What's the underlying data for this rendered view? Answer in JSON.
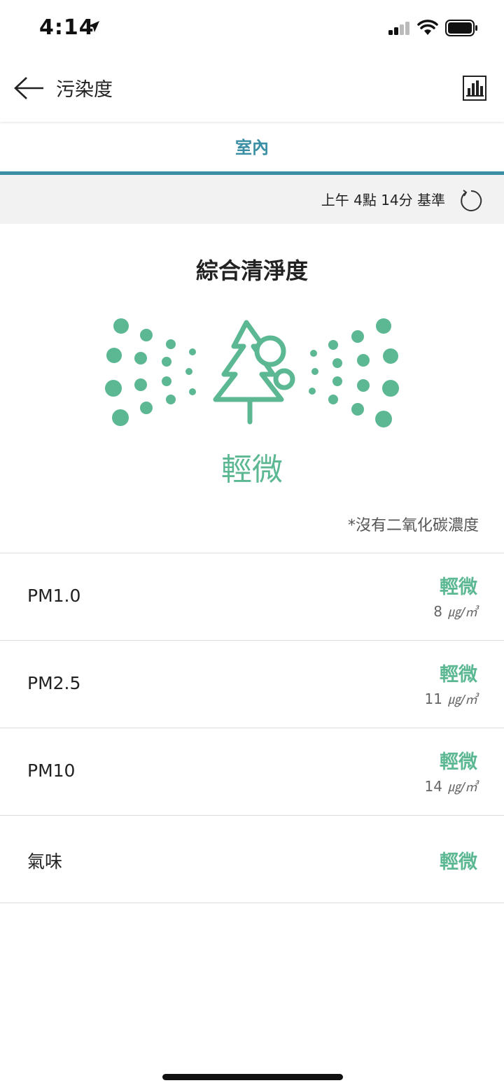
{
  "status_bar": {
    "time": "4:14"
  },
  "app_bar": {
    "title": "污染度"
  },
  "tabs": [
    {
      "label": "室內",
      "active": true
    }
  ],
  "reference": {
    "text": "上午 4點 14分 基準"
  },
  "summary": {
    "title": "綜合清淨度",
    "level": "輕微",
    "note": "*沒有二氧化碳濃度"
  },
  "items": [
    {
      "label": "PM1.0",
      "level": "輕微",
      "value": "8",
      "unit": "㎍/㎥"
    },
    {
      "label": "PM2.5",
      "level": "輕微",
      "value": "11",
      "unit": "㎍/㎥"
    },
    {
      "label": "PM10",
      "level": "輕微",
      "value": "14",
      "unit": "㎍/㎥"
    },
    {
      "label": "氣味",
      "level": "輕微"
    }
  ],
  "colors": {
    "accent": "#3a8fa4",
    "level_good": "#5cb893",
    "divider": "#dcdcdc",
    "ref_bar_bg": "#f2f2f2"
  },
  "icons": {
    "back": "arrow-left-icon",
    "chart": "bar-chart-icon",
    "refresh": "refresh-icon",
    "hero": "tree-particles-icon",
    "location": "location-arrow-icon",
    "signal": "cellular-signal-icon",
    "wifi": "wifi-icon",
    "battery": "battery-icon"
  }
}
